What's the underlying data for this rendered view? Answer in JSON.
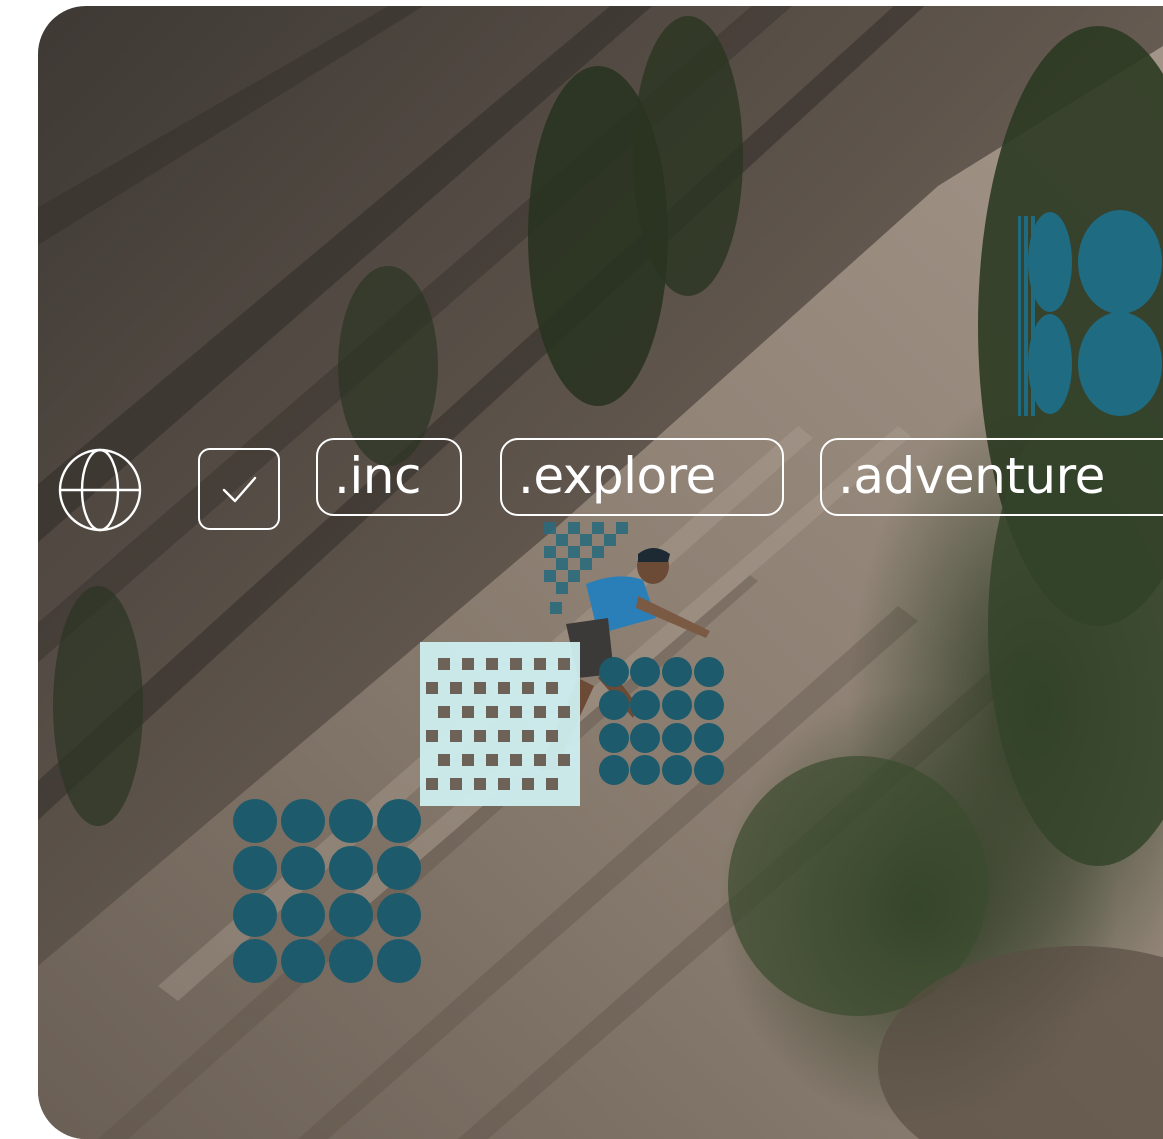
{
  "scene": {
    "description_label": "photo",
    "palette": {
      "rock_dark": "#4a4540",
      "rock_mid": "#6d6258",
      "rock_light": "#9a8c7f",
      "tree": "#2f3a24",
      "tree_light": "#4d5c36",
      "accent_teal": "#1d5a6b",
      "accent_pale": "#cfeef0",
      "chip_stroke": "#ffffff"
    }
  },
  "chips": {
    "globe_icon": "globe-icon",
    "check_icon": "check-icon",
    "inc": ".inc",
    "explore": ".explore",
    "adventure": ".adventure"
  }
}
